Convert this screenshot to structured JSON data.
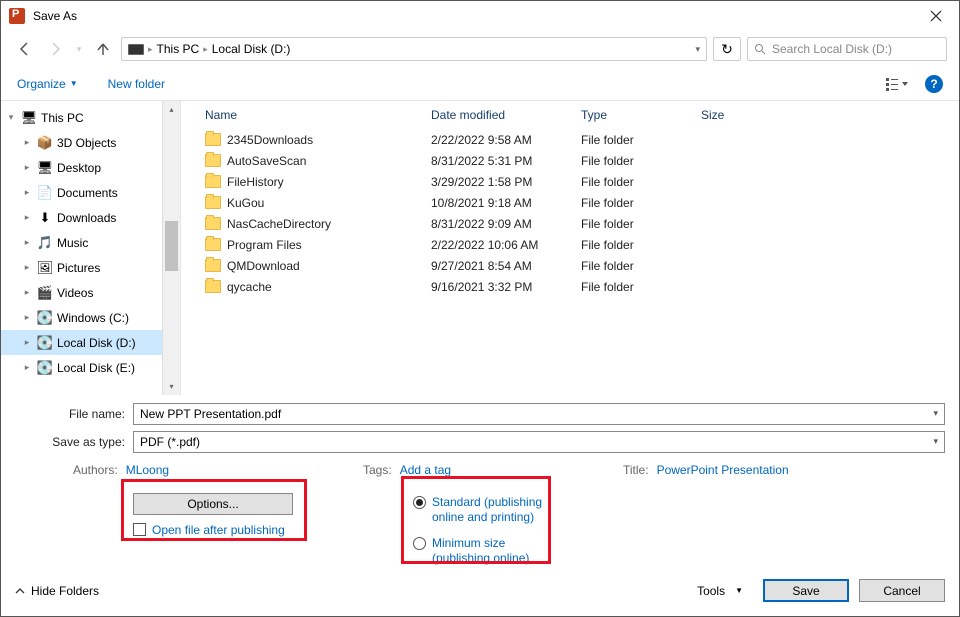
{
  "title": "Save As",
  "address": {
    "root": "This PC",
    "path": "Local Disk (D:)"
  },
  "search_placeholder": "Search Local Disk (D:)",
  "commands": {
    "organize": "Organize",
    "newfolder": "New folder"
  },
  "tree": [
    {
      "label": "This PC",
      "chev": "▾",
      "indent": 0,
      "icon": "🖥"
    },
    {
      "label": "3D Objects",
      "chev": "▸",
      "indent": 1,
      "icon": "📦"
    },
    {
      "label": "Desktop",
      "chev": "▸",
      "indent": 1,
      "icon": "🖥"
    },
    {
      "label": "Documents",
      "chev": "▸",
      "indent": 1,
      "icon": "📄"
    },
    {
      "label": "Downloads",
      "chev": "▸",
      "indent": 1,
      "icon": "⬇"
    },
    {
      "label": "Music",
      "chev": "▸",
      "indent": 1,
      "icon": "🎵"
    },
    {
      "label": "Pictures",
      "chev": "▸",
      "indent": 1,
      "icon": "🖼"
    },
    {
      "label": "Videos",
      "chev": "▸",
      "indent": 1,
      "icon": "🎬"
    },
    {
      "label": "Windows (C:)",
      "chev": "▸",
      "indent": 1,
      "icon": "💽"
    },
    {
      "label": "Local Disk (D:)",
      "chev": "▸",
      "indent": 1,
      "icon": "💽",
      "sel": true
    },
    {
      "label": "Local Disk (E:)",
      "chev": "▸",
      "indent": 1,
      "icon": "💽"
    }
  ],
  "columns": {
    "name": "Name",
    "date": "Date modified",
    "type": "Type",
    "size": "Size"
  },
  "files": [
    {
      "name": "2345Downloads",
      "date": "2/22/2022 9:58 AM",
      "type": "File folder"
    },
    {
      "name": "AutoSaveScan",
      "date": "8/31/2022 5:31 PM",
      "type": "File folder"
    },
    {
      "name": "FileHistory",
      "date": "3/29/2022 1:58 PM",
      "type": "File folder"
    },
    {
      "name": "KuGou",
      "date": "10/8/2021 9:18 AM",
      "type": "File folder"
    },
    {
      "name": "NasCacheDirectory",
      "date": "8/31/2022 9:09 AM",
      "type": "File folder"
    },
    {
      "name": "Program Files",
      "date": "2/22/2022 10:06 AM",
      "type": "File folder"
    },
    {
      "name": "QMDownload",
      "date": "9/27/2021 8:54 AM",
      "type": "File folder"
    },
    {
      "name": "qycache",
      "date": "9/16/2021 3:32 PM",
      "type": "File folder"
    }
  ],
  "filename_label": "File name:",
  "filename": "New PPT Presentation.pdf",
  "savetype_label": "Save as type:",
  "savetype": "PDF (*.pdf)",
  "meta": {
    "authors_label": "Authors:",
    "authors": "MLoong",
    "tags_label": "Tags:",
    "tags": "Add a tag",
    "title_label": "Title:",
    "title": "PowerPoint Presentation"
  },
  "options_btn": "Options...",
  "open_after": "Open file after publishing",
  "opt_standard": "Standard (publishing online and printing)",
  "opt_minimum": "Minimum size (publishing online)",
  "hide_folders": "Hide Folders",
  "tools": "Tools",
  "save": "Save",
  "cancel": "Cancel"
}
